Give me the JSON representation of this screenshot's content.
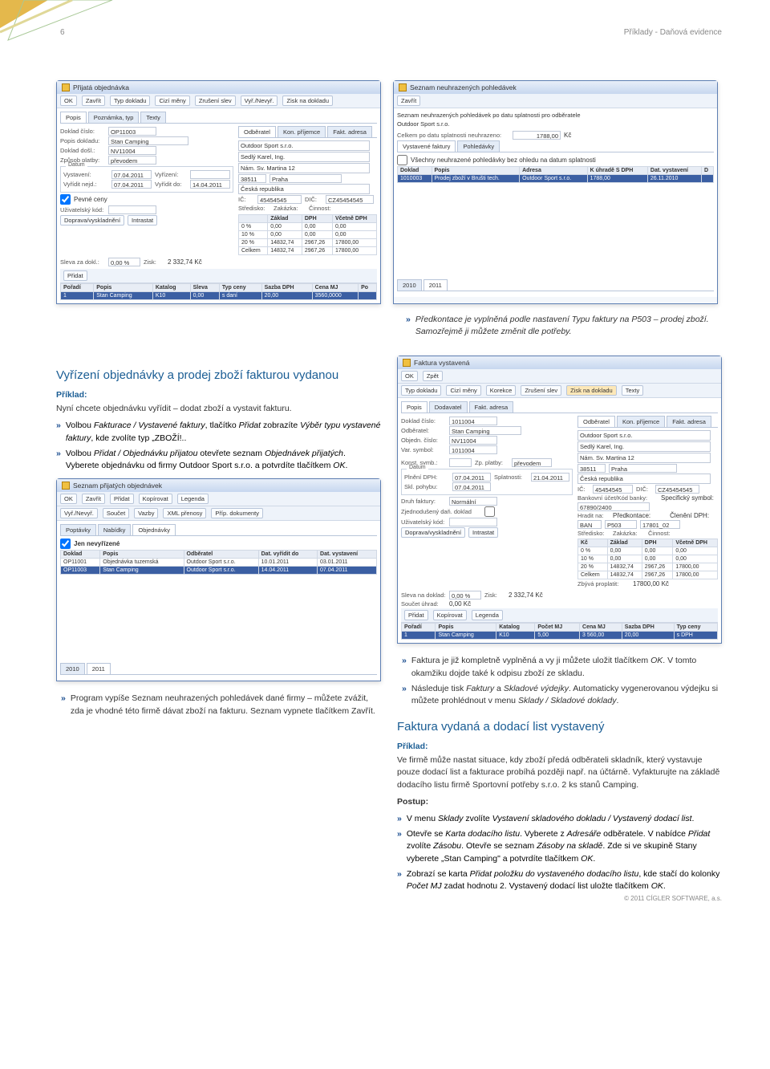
{
  "page": {
    "number": "6",
    "header_right": "Příklady - Daňová evidence",
    "footer": "© 2011 CÍGLER SOFTWARE, a.s."
  },
  "win_prijata": {
    "title": "Přijatá objednávka",
    "toolbar": [
      "OK",
      "Zavřít",
      "Typ dokladu",
      "Cizí měny",
      "Zrušení slev",
      "Vyř./Nevyř.",
      "Zisk na dokladu"
    ],
    "tabs": [
      "Popis",
      "Poznámka, typ",
      "Texty"
    ],
    "doklad_cislo_l": "Doklad číslo:",
    "doklad_cislo": "OP11003",
    "popis_l": "Popis dokladu:",
    "popis": "Stan Camping",
    "doklad_dosl_l": "Doklad došl.:",
    "doklad_dosl": "NV11004",
    "zpusob_l": "Způsob platby:",
    "zpusob": "převodem",
    "datum_s": "Datum",
    "vystaveni_l": "Vystavení:",
    "vystaveni": "07.04.2011",
    "vyrizeni_l": "Vyřízení:",
    "vyrizeni": "",
    "vyridit_nejd_l": "Vyřídit nejd.:",
    "vyridit_nejd": "07.04.2011",
    "vyridit_do_l": "Vyřídit do:",
    "vyridit_do": "14.04.2011",
    "pevne_ceny": "Pevné ceny",
    "uziv_kod_l": "Uživatelský kód:",
    "doprava_l": "Doprava/vyskladnění",
    "intrastat": "Intrastat",
    "odberatel_s": "Odběratel",
    "kon_prijemce": "Kon. příjemce",
    "fakt_adresa": "Fakt. adresa",
    "odb_name": "Outdoor Sport s.r.o.",
    "odb_person": "Sedlý Karel, Ing.",
    "odb_addr": "Nám. Sv. Martina 12",
    "odb_zip": "38511",
    "odb_city": "Praha",
    "odb_country": "Česká republika",
    "ic_l": "IČ:",
    "ic": "45454545",
    "dic_l": "DIČ:",
    "dic": "CZ45454545",
    "stredisko_l": "Středisko:",
    "zakazka_l": "Zakázka:",
    "cinnost_l": "Činnost:",
    "sum_cols": [
      "",
      "Základ",
      "DPH",
      "Včetně DPH"
    ],
    "sum_rows": [
      [
        "0 %",
        "0,00",
        "0,00",
        "0,00"
      ],
      [
        "10 %",
        "0,00",
        "0,00",
        "0,00"
      ],
      [
        "20 %",
        "14832,74",
        "2967,26",
        "17800,00"
      ],
      [
        "Celkem",
        "14832,74",
        "2967,26",
        "17800,00"
      ]
    ],
    "sleva_l": "Sleva za dokl.:",
    "sleva": "0,00 %",
    "zisk_l": "Zisk:",
    "zisk": "2 332,74 Kč",
    "pridat": "Přidat",
    "items_cols": [
      "Pořadí",
      "Popis",
      "Katalog",
      "Sleva",
      "Typ ceny",
      "Sazba DPH",
      "Cena MJ",
      "Po"
    ],
    "item_row": [
      "1",
      "Stan Camping",
      "K10",
      "0,00",
      "s daní",
      "20,00",
      "3560,0000",
      ""
    ]
  },
  "win_seznam_pohledavek": {
    "title": "Seznam neuhrazených pohledávek",
    "zavrit": "Zavřít",
    "line1": "Seznam neuhrazených pohledávek po datu splatnosti pro odběratele",
    "odb": "Outdoor Sport s.r.o.",
    "celkem_l": "Celkem po datu splatnosti neuhrazeno:",
    "celkem": "1788,00",
    "kc": "Kč",
    "tabs": [
      "Vystavené faktury",
      "Pohledávky"
    ],
    "vsechny": "Všechny neuhrazené pohledávky bez ohledu na datum splatnosti",
    "cols": [
      "Doklad",
      "Popis",
      "Adresa",
      "K úhradě S DPH",
      "Dat. vystavení",
      "D"
    ],
    "row": [
      "1010003",
      "Prodej zboží v Brušti tech.",
      "Outdoor Sport s.r.o.",
      "1788,00",
      "26.11.2010",
      ""
    ],
    "years": [
      "2010",
      "2011"
    ]
  },
  "caption_predkontace": {
    "p1": "Předkontace je vyplněná podle nastavení Typu faktury na P503 – prodej zboží. Samozřejmě ji můžete změnit dle potřeby."
  },
  "sec_vyrizeni": {
    "title": "Vyřízení objednávky a prodej zboží fakturou vydanou",
    "priklad": "Příklad:",
    "p": "Nyní chcete objednávku vyřídit – dodat zboží a vystavit fakturu.",
    "bul1_a": "Volbou ",
    "bul1_b": "Fakturace / Vystavené faktury",
    "bul1_c": ", tlačítko ",
    "bul1_d": "Přidat",
    "bul1_e": " zobrazíte ",
    "bul1_f": "Výběr typu vystavené faktury",
    "bul1_g": ", kde zvolíte typ „ZBOŽÍ!..",
    "bul2_a": "Volbou ",
    "bul2_b": "Přidat / Objednávku přijatou",
    "bul2_c": " otevřete seznam ",
    "bul2_d": "Objednávek přijatých",
    "bul2_e": ". Vyberete objednávku od firmy Outdoor Sport s.r.o. a potvrdíte tlačítkem ",
    "bul2_f": "OK"
  },
  "win_objednavky": {
    "title": "Seznam přijatých objednávek",
    "toolbar": [
      "OK",
      "Zavřít",
      "Přidat",
      "Kopírovat",
      "Legenda"
    ],
    "toolbar2": [
      "Vyř./Nevyř.",
      "Σ",
      "Součet",
      "Vazby",
      "XML přenosy",
      "Příp. dokumenty"
    ],
    "tabs": [
      "Poptávky",
      "Nabídky",
      "Objednávky"
    ],
    "jen": "Jen nevyřízené",
    "cols": [
      "Doklad",
      "Popis",
      "Odběratel",
      "Dat. vyřídit do",
      "Dat. vystavení"
    ],
    "rows": [
      [
        "OP11001",
        "Objednávka tuzemská",
        "Outdoor Sport s.r.o.",
        "10.01.2011",
        "03.01.2011"
      ],
      [
        "OP11003",
        "Stan Camping",
        "Outdoor Sport s.r.o.",
        "14.04.2011",
        "07.04.2011"
      ]
    ],
    "years": [
      "2010",
      "2011"
    ]
  },
  "win_faktura": {
    "title": "Faktura vystavená",
    "toolbar": [
      "OK",
      "Zpět"
    ],
    "toolbar2": [
      "Typ dokladu",
      "Cizí měny",
      "Korekce",
      "Zrušení slev",
      "Zisk na dokladu",
      "Texty"
    ],
    "tabs": [
      "Popis",
      "Dodavatel",
      "Fakt. adresa"
    ],
    "odb_s": "Odběratel",
    "kon_p": "Kon. příjemce",
    "fakt_a": "Fakt. adresa",
    "odb_name": "Outdoor Sport s.r.o.",
    "odb_person": "Sedlý Karel, Ing.",
    "odb_addr": "Nám. Sv. Martina 12",
    "odb_zip": "38511",
    "odb_city": "Praha",
    "odb_country": "Česká republika",
    "doklad_l": "Doklad číslo:",
    "doklad": "1011004",
    "odbf_l": "Odběratel:",
    "odbf": "Stan Camping",
    "obj_l": "Objedn. číslo:",
    "obj": "NV11004",
    "var_l": "Var. symbol:",
    "var": "1011004",
    "konst_l": "Konst. symb.:",
    "zp_l": "Zp. platby:",
    "zp": "převodem",
    "datum_s": "Datum",
    "plneni_l": "Plnění DPH:",
    "plneni": "07.04.2011",
    "splat_l": "Splatnosti:",
    "splat": "21.04.2011",
    "skl_l": "Skl. pohybu:",
    "skl": "07.04.2011",
    "druh_l": "Druh faktury:",
    "druh": "Normální",
    "zjedn_l": "Zjednodušený daň. doklad",
    "uziv_l": "Uživatelský kód:",
    "doprava_l": "Doprava/vyskladnění",
    "intrastat": "Intrastat",
    "ic_l": "IČ:",
    "ic": "45454545",
    "dic_l": "DIČ:",
    "dic": "CZ45454545",
    "banka_l": "Bankovní účet/Kód banky:",
    "banka": "67890/2400",
    "spec_l": "Specifický symbol:",
    "hradit_l": "Hradit na:",
    "hradit": "P503",
    "predk_l": "Předkontace:",
    "cleneni_l": "Členění DPH:",
    "cleneni": "17801_02",
    "hban": "BAN",
    "stred_l": "Středisko:",
    "zak_l": "Zakázka:",
    "cin_l": "Činnost:",
    "sum_cols": [
      "Kč",
      "Základ",
      "DPH",
      "Včetně DPH"
    ],
    "sum_rows": [
      [
        "0 %",
        "0,00",
        "0,00",
        "0,00"
      ],
      [
        "10 %",
        "0,00",
        "0,00",
        "0,00"
      ],
      [
        "20 %",
        "14832,74",
        "2967,26",
        "17800,00"
      ],
      [
        "Celkem",
        "14832,74",
        "2967,26",
        "17800,00"
      ]
    ],
    "zbyva_l": "Zbývá proplatit:",
    "zbyva": "17800,00 Kč",
    "sleva_l": "Sleva na doklad:",
    "sleva": "0,00 %",
    "zisk_l": "Zisk:",
    "zisk": "2 332,74 Kč",
    "soucet_l": "Součet úhrad:",
    "soucet": "0,00 Kč",
    "pridat": "Přidat",
    "kop": "Kopírovat",
    "leg": "Legenda",
    "items_cols": [
      "Pořadí",
      "Popis",
      "Katalog",
      "Počet MJ",
      "Cena MJ",
      "Sazba DPH",
      "Typ ceny"
    ],
    "item_row": [
      "1",
      "Stan Camping",
      "K10",
      "5,00",
      "3 560,00",
      "20,00",
      "s DPH"
    ]
  },
  "lower_left": {
    "bul": "Program vypíše Seznam neuhrazených pohledávek dané firmy – můžete zvážit, zda je vhodné této firmě dávat zboží na fakturu. Seznam vypnete tlačítkem Zavřít."
  },
  "lower_right": {
    "bul1_a": "Faktura je již kompletně vyplněná a vy ji můžete uložit tlačítkem ",
    "bul1_b": "OK",
    "bul1_c": ". V tomto okamžiku dojde také k odpisu zboží ze skladu.",
    "bul2_a": "Následuje tisk ",
    "bul2_b": "Faktury",
    "bul2_c": " a ",
    "bul2_d": "Skladové výdejky",
    "bul2_e": ". Automaticky vygenerovanou výdejku si můžete prohlédnout v menu ",
    "bul2_f": "Sklady / Skladové doklady",
    "bul2_g": ".",
    "sec_title": "Faktura vydaná a dodací list vystavený",
    "priklad": "Příklad:",
    "p": "Ve firmě může nastat situace, kdy zboží předá odběrateli skladník, který vystavuje pouze dodací list a fakturace probíhá později např. na účtárně. Vyfakturujte na základě dodacího listu firmě Sportovní potřeby s.r.o. 2 ks stanů Camping.",
    "postup": "Postup:",
    "b1_a": "V menu ",
    "b1_b": "Sklady",
    "b1_c": " zvolíte ",
    "b1_d": "Vystavení skladového dokladu / Vystavený dodací list",
    "b1_e": ".",
    "b2_a": "Otevře se ",
    "b2_b": "Karta dodacího listu",
    "b2_c": ". Vyberete z ",
    "b2_d": "Adresáře",
    "b2_e": " odběratele. V nabídce ",
    "b2_f": "Přidat",
    "b2_g": " zvolíte ",
    "b2_h": "Zásobu",
    "b2_i": ". Otevře se seznam ",
    "b2_j": "Zásoby na skladě",
    "b2_k": ". Zde si ve skupině Stany vyberete „Stan Camping\" a potvrdíte tlačítkem ",
    "b2_l": "OK",
    "b2_m": ".",
    "b3_a": "Zobrazí se karta ",
    "b3_b": "Přidat položku do vystaveného dodacího listu",
    "b3_c": ", kde stačí do kolonky ",
    "b3_d": "Počet MJ",
    "b3_e": " zadat hodnotu 2. Vystavený dodací list uložte tlačítkem ",
    "b3_f": "OK",
    "b3_g": "."
  }
}
